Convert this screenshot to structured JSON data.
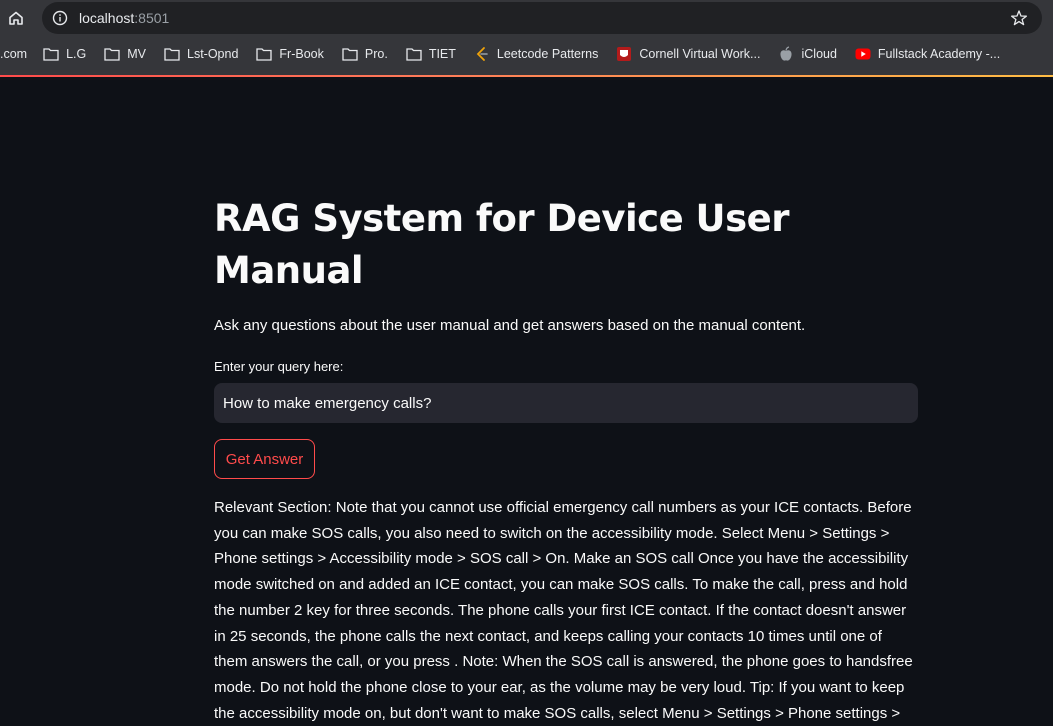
{
  "browser": {
    "url_host": "localhost",
    "url_port": ":8501",
    "bookmarks": [
      {
        "label": ".com",
        "icon": "none"
      },
      {
        "label": "L.G",
        "icon": "folder-icon"
      },
      {
        "label": "MV",
        "icon": "folder-icon"
      },
      {
        "label": "Lst-Opnd",
        "icon": "folder-icon"
      },
      {
        "label": "Fr-Book",
        "icon": "folder-icon"
      },
      {
        "label": "Pro.",
        "icon": "folder-icon"
      },
      {
        "label": "TIET",
        "icon": "folder-icon"
      },
      {
        "label": "Leetcode Patterns",
        "icon": "leetcode-icon"
      },
      {
        "label": "Cornell Virtual Work...",
        "icon": "cornell-icon"
      },
      {
        "label": "iCloud",
        "icon": "apple-icon"
      },
      {
        "label": "Fullstack Academy -...",
        "icon": "youtube-icon"
      }
    ]
  },
  "app": {
    "title": "RAG System for Device User Manual",
    "subtitle": "Ask any questions about the user manual and get answers based on the manual content.",
    "query_label": "Enter your query here:",
    "query_value": "How to make emergency calls?",
    "button_label": "Get Answer",
    "answer_text": "Relevant Section: Note that you cannot use official emergency call numbers as your ICE contacts. Before you can make SOS calls, you also need to switch on the accessibility mode. Select Menu > Settings > Phone settings > Accessibility mode > SOS call > On. Make an SOS call Once you have the accessibility mode switched on and added an ICE contact, you can make SOS calls. To make the call, press and hold the number 2 key for three seconds. The phone calls your first ICE contact. If the contact doesn't answer in 25 seconds, the phone calls the next contact, and keeps calling your contacts 10 times until one of them answers the call, or you press . Note: When the SOS call is answered, the phone goes to handsfree mode. Do not hold the phone close to your ear, as the volume may be very loud. Tip: If you want to keep the accessibility mode on, but don't want to make SOS calls, select Menu > Settings > Phone settings >"
  },
  "colors": {
    "background": "#0e1117",
    "accent": "#ff4b4b",
    "input_bg": "#262730"
  }
}
